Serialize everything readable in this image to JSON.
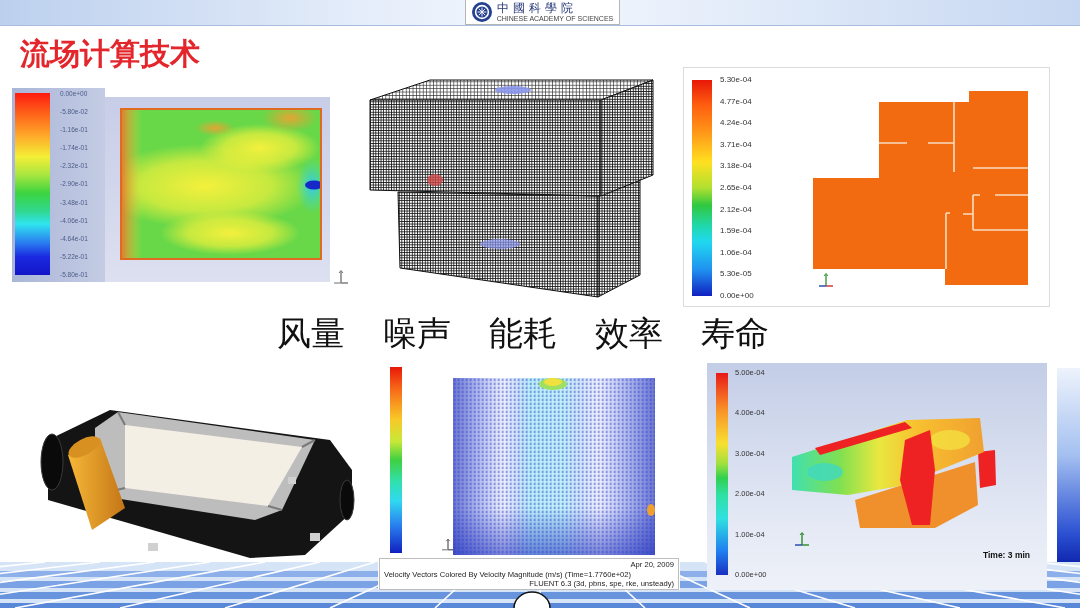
{
  "header": {
    "logo_title": "中國科學院",
    "logo_subtitle": "CHINESE ACADEMY OF SCIENCES"
  },
  "title": "流场计算技术",
  "figures": [
    {
      "kind": "contour_2d",
      "legend": [
        "0.00e+00",
        "-5.80e-02",
        "-1.16e-01",
        "-1.74e-01",
        "-2.32e-01",
        "-2.90e-01",
        "-3.48e-01",
        "-4.06e-01",
        "-4.64e-01",
        "-5.22e-01",
        "-5.80e-01"
      ]
    },
    {
      "kind": "mesh"
    },
    {
      "kind": "floor_plan",
      "legend": [
        "5.30e-04",
        "4.77e-04",
        "4.24e-04",
        "3.71e-04",
        "3.18e-04",
        "2.65e-04",
        "2.12e-04",
        "1.59e-04",
        "1.06e-04",
        "5.30e-05",
        "0.00e+00"
      ]
    },
    {
      "kind": "device"
    },
    {
      "kind": "vectors",
      "caption": "Velocity Vectors Colored By Velocity Magnitude (m/s) (Time=1.7760e+02)",
      "date": "Apr 20, 2009",
      "solver": "FLUENT 6.3 (3d, pbns, spe, rke, unsteady)"
    },
    {
      "kind": "contour_3d",
      "legend": [
        "5.00e-04",
        "4.00e-04",
        "3.00e-04",
        "2.00e-04",
        "1.00e-04",
        "0.00e+00"
      ],
      "time": "Time: 3 min"
    }
  ],
  "keywords": [
    "风量",
    "噪声",
    "能耗",
    "效率",
    "寿命"
  ]
}
